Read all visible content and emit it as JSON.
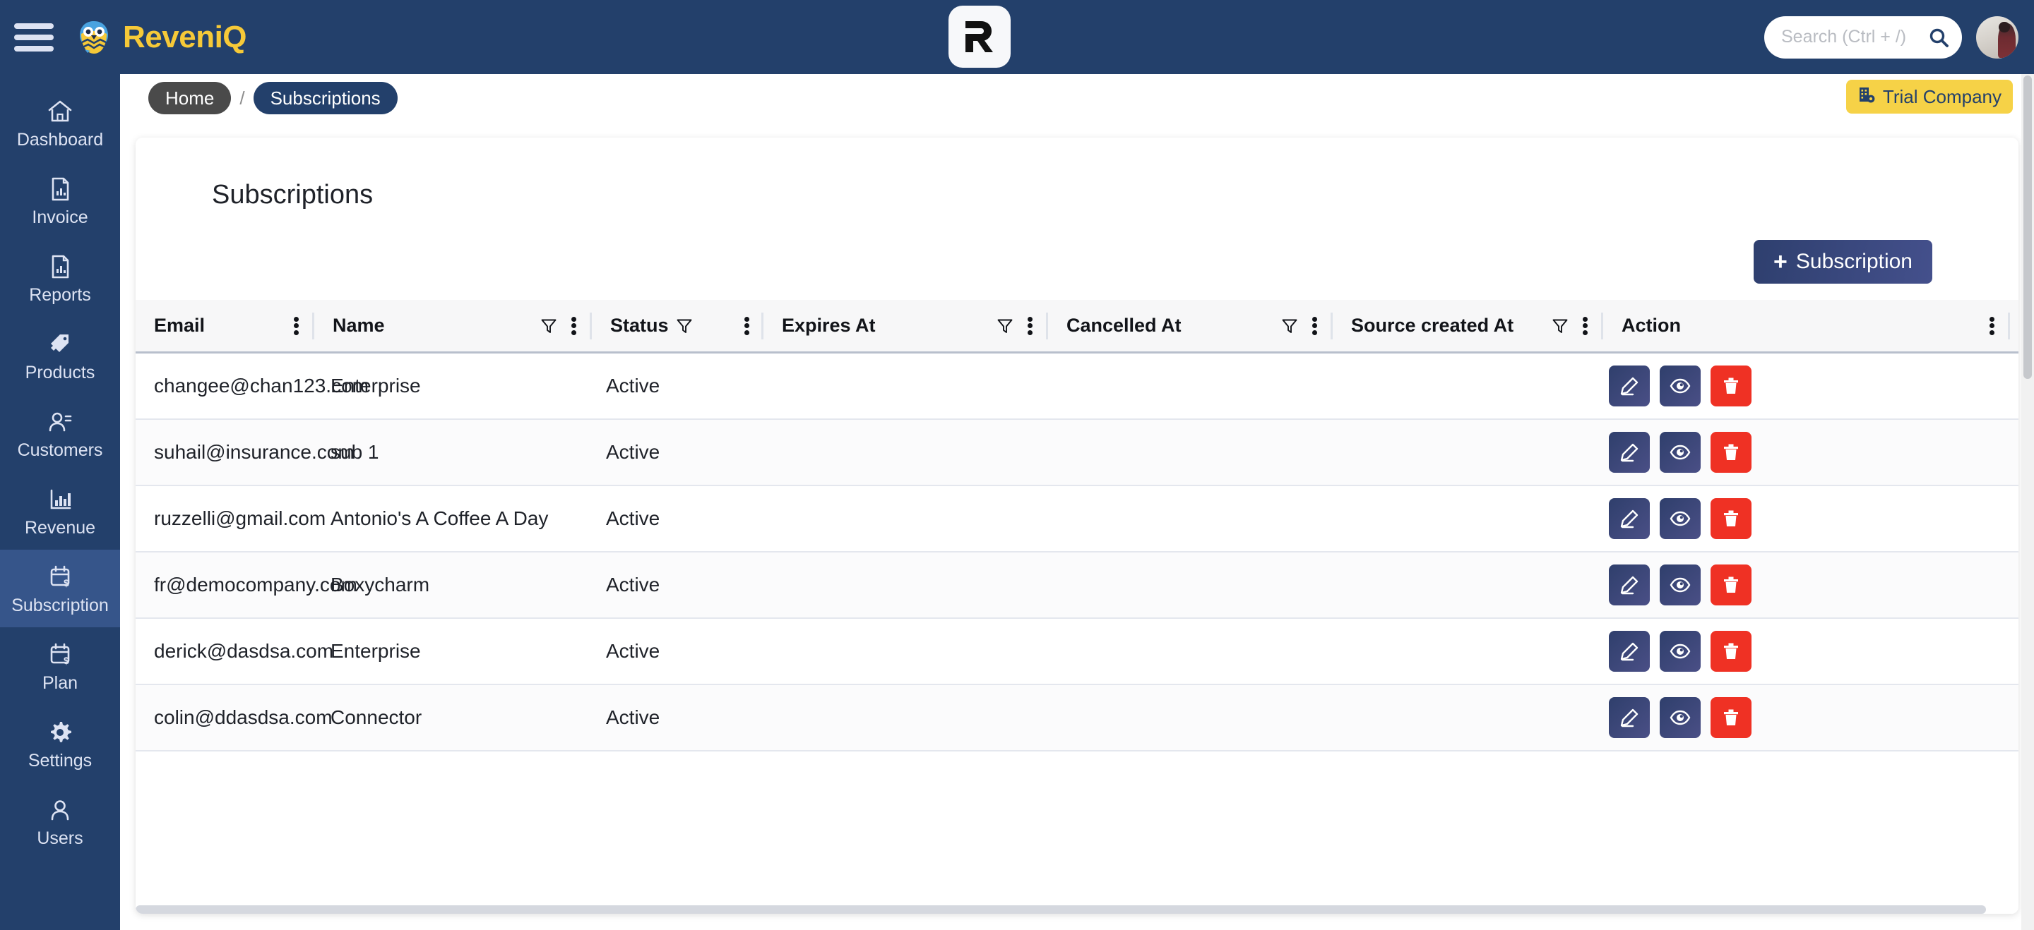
{
  "topbar": {
    "menu_icon": "hamburger-icon",
    "brand_name": "ReveniQ",
    "brand_icon": "owl-logo-icon",
    "center_logo_icon": "r-logo-icon",
    "search": {
      "value": "",
      "placeholder": "Search (Ctrl + /)",
      "icon": "search-icon"
    },
    "avatar_icon": "user-avatar"
  },
  "sidebar": {
    "items": [
      {
        "label": "Dashboard",
        "icon": "home-icon",
        "active": false
      },
      {
        "label": "Invoice",
        "icon": "document-chart-icon",
        "active": false
      },
      {
        "label": "Reports",
        "icon": "document-chart-icon",
        "active": false
      },
      {
        "label": "Products",
        "icon": "tag-icon",
        "active": false
      },
      {
        "label": "Customers",
        "icon": "users-icon",
        "active": false
      },
      {
        "label": "Revenue",
        "icon": "bar-chart-icon",
        "active": false
      },
      {
        "label": "Subscription",
        "icon": "calendar-dollar-icon",
        "active": true
      },
      {
        "label": "Plan",
        "icon": "calendar-dollar-icon",
        "active": false
      },
      {
        "label": "Settings",
        "icon": "gear-icon",
        "active": false
      },
      {
        "label": "Users",
        "icon": "person-icon",
        "active": false
      }
    ]
  },
  "breadcrumb": {
    "home": "Home",
    "separator": "/",
    "current": "Subscriptions"
  },
  "trial_badge": {
    "label": "Trial Company",
    "icon": "building-gear-icon"
  },
  "page": {
    "title": "Subscriptions",
    "add_button": {
      "label": "Subscription",
      "plus": "+"
    }
  },
  "table": {
    "columns": [
      {
        "key": "email",
        "label": "Email",
        "filter": false,
        "kebab": true
      },
      {
        "key": "name",
        "label": "Name",
        "filter": true,
        "kebab": true
      },
      {
        "key": "status",
        "label": "Status",
        "filter": true,
        "kebab": true
      },
      {
        "key": "expires",
        "label": "Expires At",
        "filter": true,
        "kebab": true
      },
      {
        "key": "cancel",
        "label": "Cancelled At",
        "filter": true,
        "kebab": true
      },
      {
        "key": "source",
        "label": "Source created At",
        "filter": true,
        "kebab": true
      },
      {
        "key": "action",
        "label": "Action",
        "filter": false,
        "kebab": true
      }
    ],
    "rows": [
      {
        "email": "changee@chan123.com",
        "name": "Enterprise",
        "status": "Active",
        "expires": "",
        "cancel": "",
        "source": ""
      },
      {
        "email": "suhail@insurance.com",
        "name": "sub 1",
        "status": "Active",
        "expires": "",
        "cancel": "",
        "source": ""
      },
      {
        "email": "ruzzelli@gmail.com",
        "name": "Antonio's A Coffee A Day",
        "status": "Active",
        "expires": "",
        "cancel": "",
        "source": ""
      },
      {
        "email": "fr@democompany.com",
        "name": "Boxycharm",
        "status": "Active",
        "expires": "",
        "cancel": "",
        "source": ""
      },
      {
        "email": "derick@dasdsa.com",
        "name": "Enterprise",
        "status": "Active",
        "expires": "",
        "cancel": "",
        "source": ""
      },
      {
        "email": "colin@ddasdsa.com",
        "name": "Connector",
        "status": "Active",
        "expires": "",
        "cancel": "",
        "source": ""
      }
    ],
    "row_actions": [
      {
        "name": "edit-button",
        "icon": "pencil-icon"
      },
      {
        "name": "view-button",
        "icon": "eye-icon"
      },
      {
        "name": "delete-button",
        "icon": "trash-icon"
      }
    ]
  },
  "colors": {
    "navy": "#23406b",
    "navy_active": "#36558a",
    "brand_yellow": "#f6c938",
    "trial_yellow": "#f6d247",
    "danger_red": "#ef3124",
    "crumb_home_gray": "#4a4a4a"
  }
}
